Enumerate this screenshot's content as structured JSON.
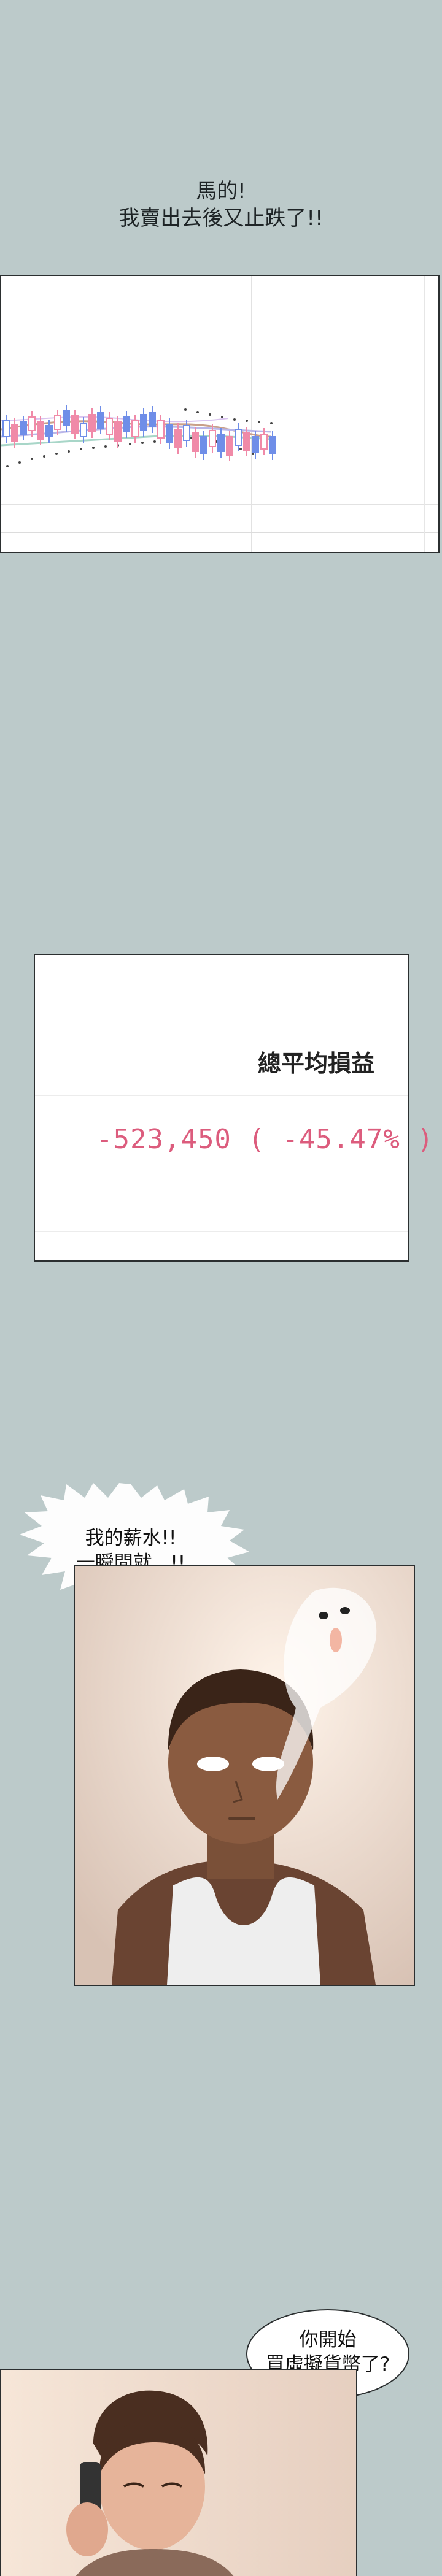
{
  "caption": {
    "line1": "馬的!",
    "line2": "我賣出去後又止跌了!!"
  },
  "pl_panel": {
    "title": "總平均損益",
    "value": "-523,450 ( -45.47% )",
    "value_color": "#dc5c7d"
  },
  "shout_bubble": {
    "line1": "我的薪水!!",
    "line2": "一瞬間就...!!"
  },
  "speech_bubble": {
    "line1": "你開始",
    "line2": "買虛擬貨幣了?"
  },
  "colors": {
    "background": "#bccaca",
    "candle_up": "#f08aa8",
    "candle_down": "#6f8ee8"
  }
}
